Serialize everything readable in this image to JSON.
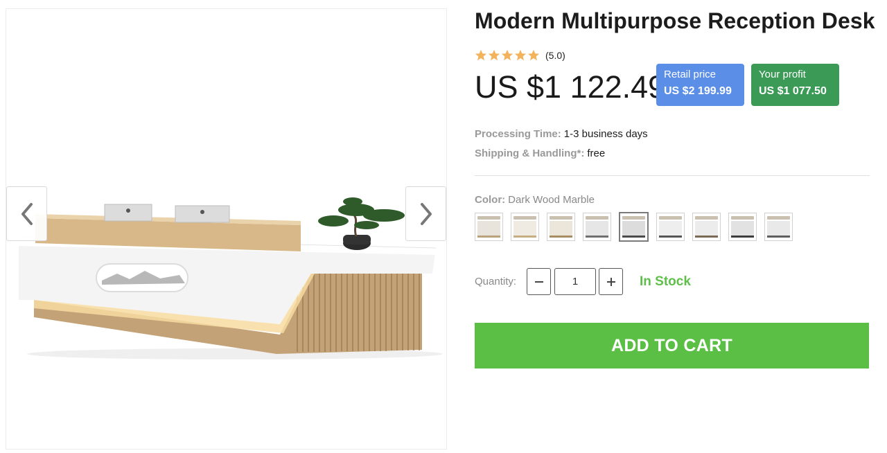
{
  "product": {
    "title": "Modern Multipurpose Reception Desk",
    "rating": {
      "stars": 5,
      "value_text": "(5.0)",
      "star_color": "#f3b35c"
    },
    "price": "US $1 122.49",
    "retail": {
      "label": "Retail price",
      "value": "US $2 199.99",
      "color": "#5b8ee6"
    },
    "profit": {
      "label": "Your profit",
      "value": "US $1 077.50",
      "color": "#3c9a57"
    }
  },
  "meta": {
    "processing_label": "Processing Time:",
    "processing_value": "1-3 business days",
    "shipping_label": "Shipping & Handling*:",
    "shipping_value": "free"
  },
  "color": {
    "label": "Color:",
    "selected": "Dark Wood Marble",
    "swatch_count": 9,
    "selected_index": 4
  },
  "quantity": {
    "label": "Quantity:",
    "value": "1",
    "minus_icon": "minus-icon",
    "plus_icon": "plus-icon"
  },
  "stock": {
    "text": "In Stock",
    "color": "#5fbf4a"
  },
  "cart": {
    "label": "ADD TO CART",
    "color": "#5cbf45"
  },
  "gallery": {
    "prev_icon": "chevron-left-icon",
    "next_icon": "chevron-right-icon"
  }
}
